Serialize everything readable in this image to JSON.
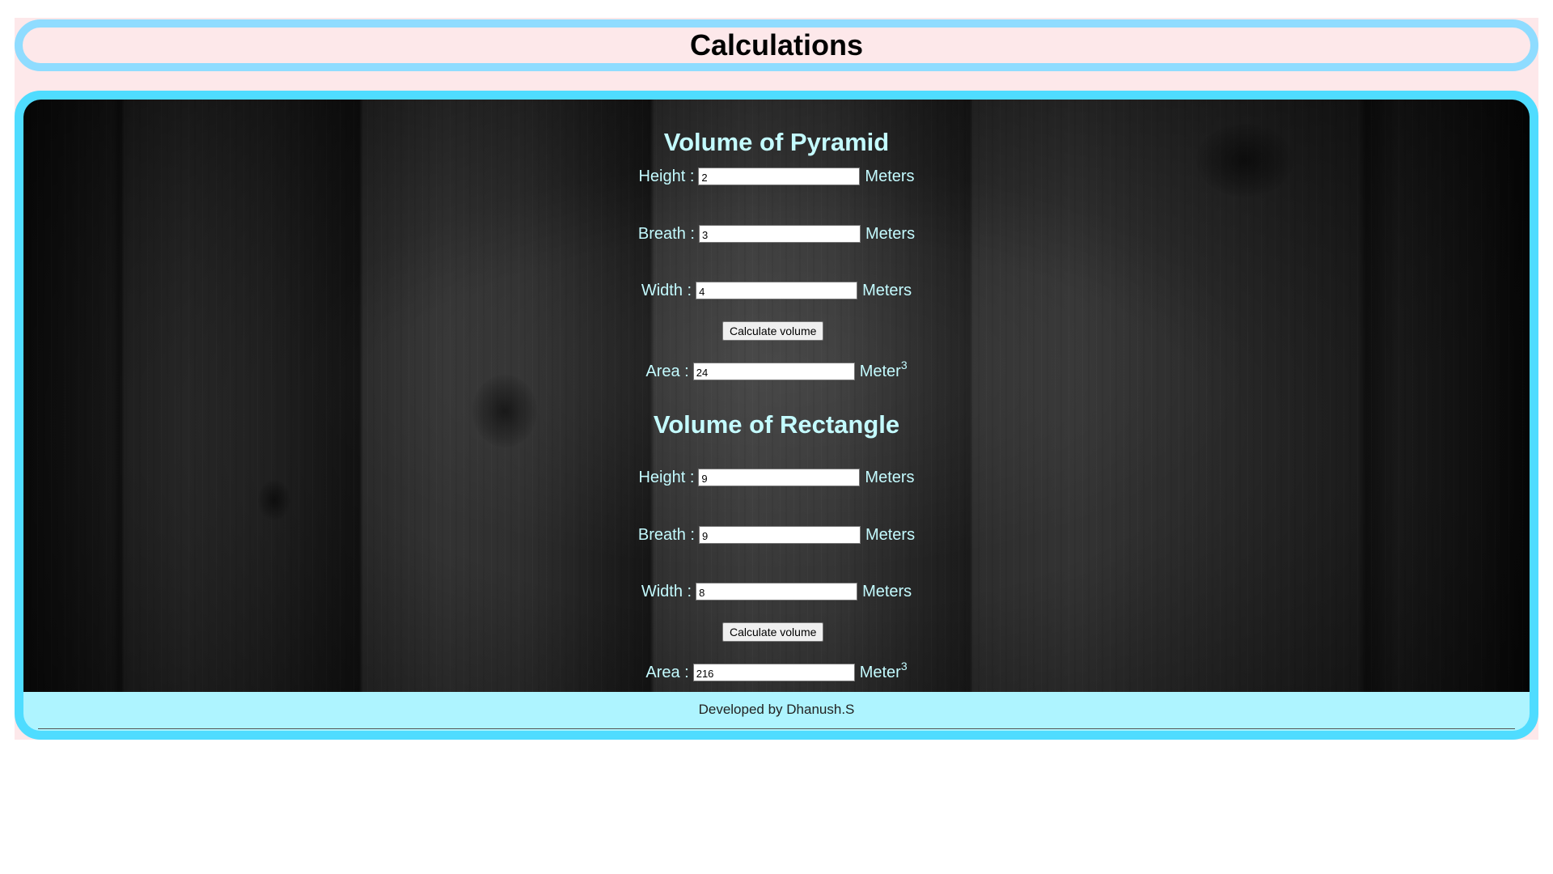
{
  "header": {
    "title": "Calculations"
  },
  "pyramid": {
    "title": "Volume of Pyramid",
    "height": {
      "label": "Height :",
      "value": "2",
      "unit": "Meters"
    },
    "breath": {
      "label": "Breath :",
      "value": "3",
      "unit": "Meters"
    },
    "width": {
      "label": "Width :",
      "value": "4",
      "unit": "Meters"
    },
    "button": "Calculate volume",
    "area": {
      "label": "Area :",
      "value": "24",
      "unit": "Meter",
      "unit_sup": "3"
    }
  },
  "rectangle": {
    "title": "Volume of Rectangle",
    "height": {
      "label": "Height :",
      "value": "9",
      "unit": "Meters"
    },
    "breath": {
      "label": "Breath :",
      "value": "9",
      "unit": "Meters"
    },
    "width": {
      "label": "Width :",
      "value": "8",
      "unit": "Meters"
    },
    "button": "Calculate volume",
    "area": {
      "label": "Area :",
      "value": "216",
      "unit": "Meter",
      "unit_sup": "3"
    }
  },
  "footer": {
    "text": "Developed by Dhanush.S"
  },
  "colors": {
    "header_border": "#8fdcff",
    "main_border": "#4fdcff",
    "page_bg": "#fde8ea",
    "label_text": "#c4fbff",
    "footer_bg": "#aef4ff"
  }
}
